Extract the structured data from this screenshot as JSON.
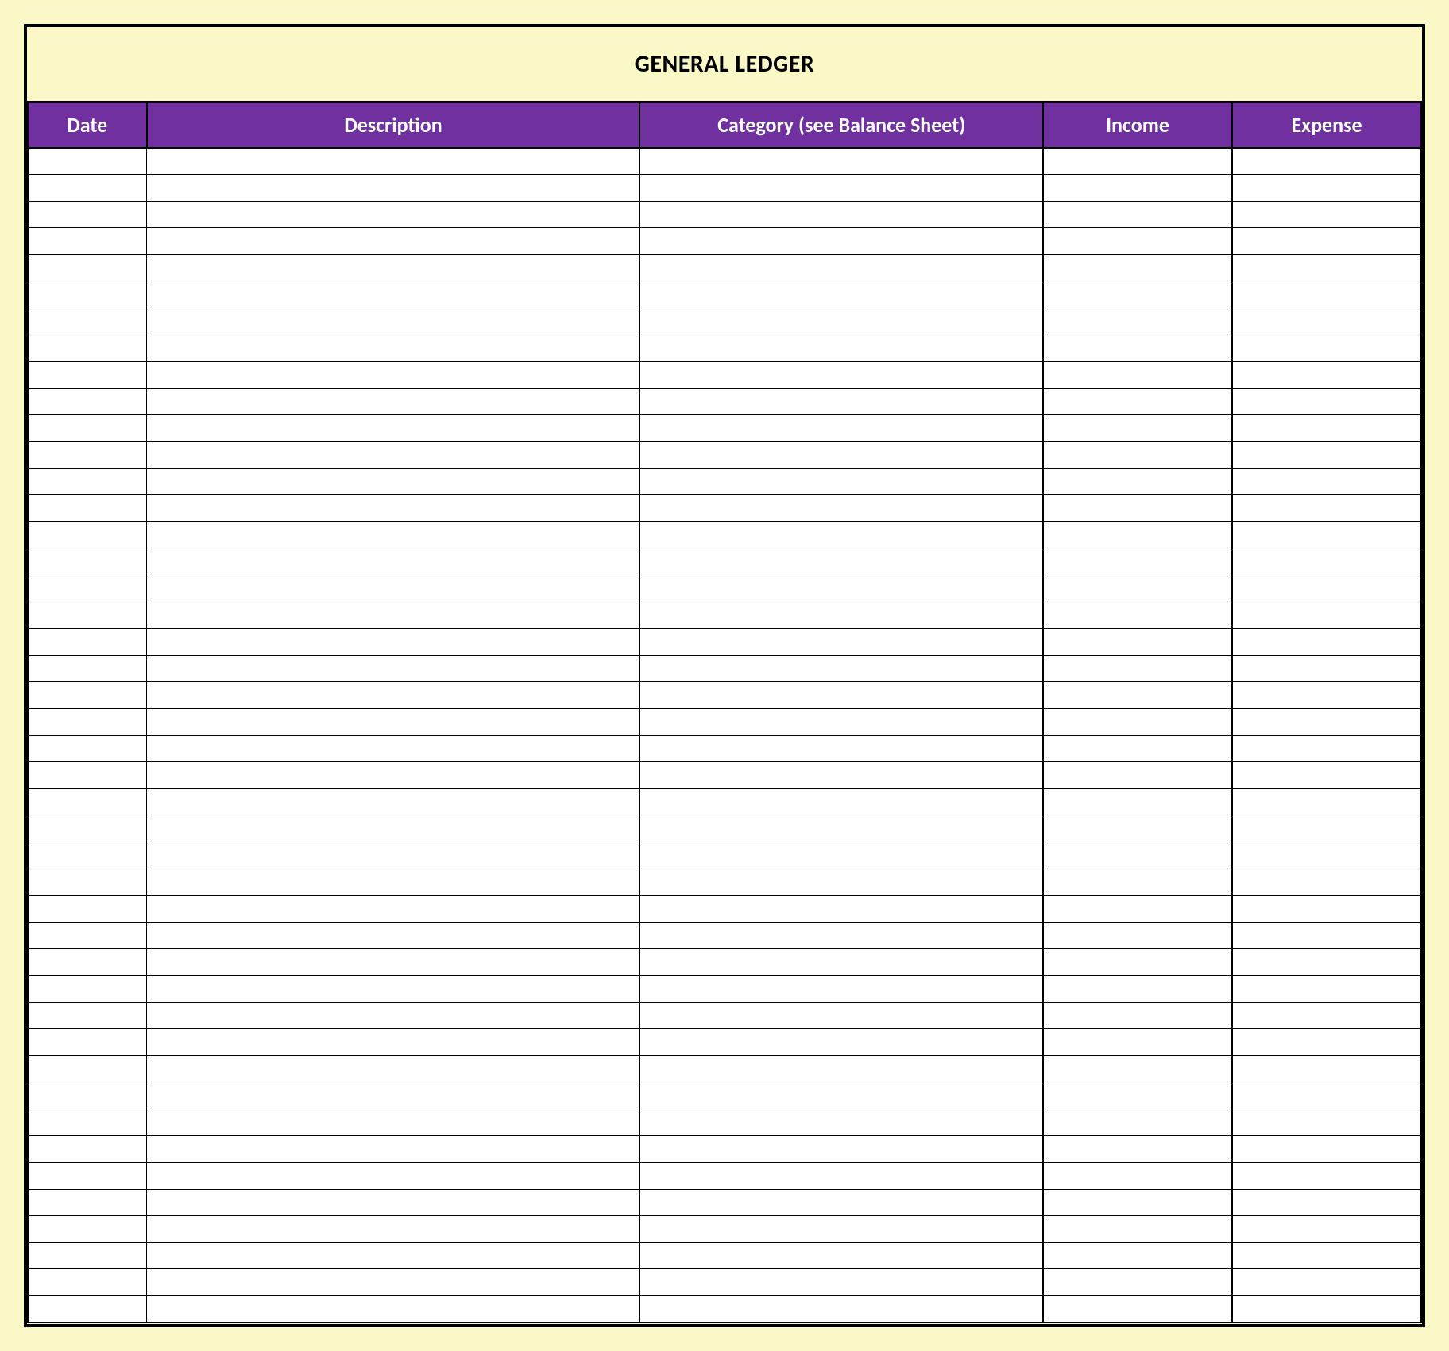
{
  "title": "GENERAL LEDGER",
  "columns": {
    "date": "Date",
    "description": "Description",
    "category": "Category (see Balance Sheet)",
    "income": "Income",
    "expense": "Expense"
  },
  "rows": [
    {
      "date": "",
      "description": "",
      "category": "",
      "income": "",
      "expense": ""
    },
    {
      "date": "",
      "description": "",
      "category": "",
      "income": "",
      "expense": ""
    },
    {
      "date": "",
      "description": "",
      "category": "",
      "income": "",
      "expense": ""
    },
    {
      "date": "",
      "description": "",
      "category": "",
      "income": "",
      "expense": ""
    },
    {
      "date": "",
      "description": "",
      "category": "",
      "income": "",
      "expense": ""
    },
    {
      "date": "",
      "description": "",
      "category": "",
      "income": "",
      "expense": ""
    },
    {
      "date": "",
      "description": "",
      "category": "",
      "income": "",
      "expense": ""
    },
    {
      "date": "",
      "description": "",
      "category": "",
      "income": "",
      "expense": ""
    },
    {
      "date": "",
      "description": "",
      "category": "",
      "income": "",
      "expense": ""
    },
    {
      "date": "",
      "description": "",
      "category": "",
      "income": "",
      "expense": ""
    },
    {
      "date": "",
      "description": "",
      "category": "",
      "income": "",
      "expense": ""
    },
    {
      "date": "",
      "description": "",
      "category": "",
      "income": "",
      "expense": ""
    },
    {
      "date": "",
      "description": "",
      "category": "",
      "income": "",
      "expense": ""
    },
    {
      "date": "",
      "description": "",
      "category": "",
      "income": "",
      "expense": ""
    },
    {
      "date": "",
      "description": "",
      "category": "",
      "income": "",
      "expense": ""
    },
    {
      "date": "",
      "description": "",
      "category": "",
      "income": "",
      "expense": ""
    },
    {
      "date": "",
      "description": "",
      "category": "",
      "income": "",
      "expense": ""
    },
    {
      "date": "",
      "description": "",
      "category": "",
      "income": "",
      "expense": ""
    },
    {
      "date": "",
      "description": "",
      "category": "",
      "income": "",
      "expense": ""
    },
    {
      "date": "",
      "description": "",
      "category": "",
      "income": "",
      "expense": ""
    },
    {
      "date": "",
      "description": "",
      "category": "",
      "income": "",
      "expense": ""
    },
    {
      "date": "",
      "description": "",
      "category": "",
      "income": "",
      "expense": ""
    },
    {
      "date": "",
      "description": "",
      "category": "",
      "income": "",
      "expense": ""
    },
    {
      "date": "",
      "description": "",
      "category": "",
      "income": "",
      "expense": ""
    },
    {
      "date": "",
      "description": "",
      "category": "",
      "income": "",
      "expense": ""
    },
    {
      "date": "",
      "description": "",
      "category": "",
      "income": "",
      "expense": ""
    },
    {
      "date": "",
      "description": "",
      "category": "",
      "income": "",
      "expense": ""
    },
    {
      "date": "",
      "description": "",
      "category": "",
      "income": "",
      "expense": ""
    },
    {
      "date": "",
      "description": "",
      "category": "",
      "income": "",
      "expense": ""
    },
    {
      "date": "",
      "description": "",
      "category": "",
      "income": "",
      "expense": ""
    },
    {
      "date": "",
      "description": "",
      "category": "",
      "income": "",
      "expense": ""
    },
    {
      "date": "",
      "description": "",
      "category": "",
      "income": "",
      "expense": ""
    },
    {
      "date": "",
      "description": "",
      "category": "",
      "income": "",
      "expense": ""
    },
    {
      "date": "",
      "description": "",
      "category": "",
      "income": "",
      "expense": ""
    },
    {
      "date": "",
      "description": "",
      "category": "",
      "income": "",
      "expense": ""
    },
    {
      "date": "",
      "description": "",
      "category": "",
      "income": "",
      "expense": ""
    },
    {
      "date": "",
      "description": "",
      "category": "",
      "income": "",
      "expense": ""
    },
    {
      "date": "",
      "description": "",
      "category": "",
      "income": "",
      "expense": ""
    },
    {
      "date": "",
      "description": "",
      "category": "",
      "income": "",
      "expense": ""
    },
    {
      "date": "",
      "description": "",
      "category": "",
      "income": "",
      "expense": ""
    },
    {
      "date": "",
      "description": "",
      "category": "",
      "income": "",
      "expense": ""
    },
    {
      "date": "",
      "description": "",
      "category": "",
      "income": "",
      "expense": ""
    },
    {
      "date": "",
      "description": "",
      "category": "",
      "income": "",
      "expense": ""
    },
    {
      "date": "",
      "description": "",
      "category": "",
      "income": "",
      "expense": ""
    }
  ]
}
